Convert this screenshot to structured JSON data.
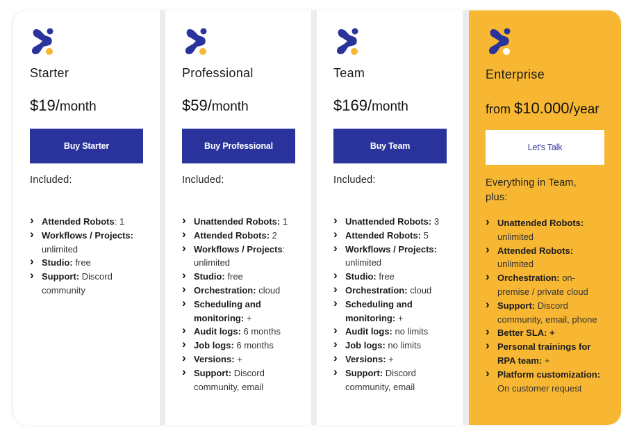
{
  "colors": {
    "brand_blue": "#29339b",
    "accent_yellow": "#f7b733",
    "card_bg": "#ffffff"
  },
  "plans": [
    {
      "logo_icon": "robot-dots-logo-icon",
      "name": "Starter",
      "price_amount": "$19/",
      "price_unit": "month",
      "button_label": "Buy Starter",
      "included_label": "Included:",
      "features": [
        {
          "label": "Attended Robots",
          "sep": ": ",
          "value": "1"
        },
        {
          "label": "Workflows / Projects:",
          "sep": " ",
          "value": "unlimited"
        },
        {
          "label": "Studio:",
          "sep": " ",
          "value": "free"
        },
        {
          "label": "Support:",
          "sep": " ",
          "value": "Discord community"
        }
      ]
    },
    {
      "logo_icon": "robot-dots-logo-icon",
      "name": "Professional",
      "price_amount": "$59/",
      "price_unit": "month",
      "button_label": "Buy Professional",
      "included_label": "Included:",
      "features": [
        {
          "label": "Unattended Robots:",
          "sep": " ",
          "value": "1"
        },
        {
          "label": "Attended Robots:",
          "sep": " ",
          "value": "2"
        },
        {
          "label": "Workflows / Projects",
          "sep": ": ",
          "value": "unlimited"
        },
        {
          "label": "Studio:",
          "sep": " ",
          "value": "free"
        },
        {
          "label": "Orchestration:",
          "sep": " ",
          "value": "cloud"
        },
        {
          "label": "Scheduling and monitoring:",
          "sep": " ",
          "value": "+"
        },
        {
          "label": "Audit logs:",
          "sep": " ",
          "value": "6 months"
        },
        {
          "label": "Job logs:",
          "sep": " ",
          "value": "6 months"
        },
        {
          "label": "Versions:",
          "sep": " ",
          "value": "+"
        },
        {
          "label": "Support:",
          "sep": " ",
          "value": "Discord community, email"
        }
      ]
    },
    {
      "logo_icon": "robot-dots-logo-icon",
      "name": "Team",
      "price_amount": "$169/",
      "price_unit": "month",
      "button_label": "Buy Team",
      "included_label": "Included:",
      "features": [
        {
          "label": "Unattended Robots:",
          "sep": " ",
          "value": "3"
        },
        {
          "label": "Attended Robots:",
          "sep": " ",
          "value": "5"
        },
        {
          "label": "Workflows / Projects:",
          "sep": " ",
          "value": "unlimited"
        },
        {
          "label": "Studio:",
          "sep": " ",
          "value": "free"
        },
        {
          "label": "Orchestration:",
          "sep": " ",
          "value": "cloud"
        },
        {
          "label": "Scheduling and monitoring:",
          "sep": " ",
          "value": "+"
        },
        {
          "label": "Audit logs:",
          "sep": " ",
          "value": "no limits"
        },
        {
          "label": "Job logs:",
          "sep": " ",
          "value": "no limits"
        },
        {
          "label": "Versions:",
          "sep": " ",
          "value": "+"
        },
        {
          "label": "Support:",
          "sep": " ",
          "value": "Discord community, email"
        }
      ]
    },
    {
      "logo_icon": "robot-dots-logo-icon",
      "name": "Enterprise",
      "price_prefix": "from ",
      "price_amount": "$10.000/",
      "price_unit": "year",
      "button_label": "Let's Talk",
      "included_label": "Everything in Team, plus:",
      "features": [
        {
          "label": "Unattended Robots:",
          "sep": " ",
          "value": "unlimited"
        },
        {
          "label": "Attended Robots:",
          "sep": " ",
          "value": "unlimited"
        },
        {
          "label": "Orchestration:",
          "sep": " ",
          "value": "on-premise / private cloud"
        },
        {
          "label": "Support:",
          "sep": " ",
          "value": "Discord community, email, phone"
        },
        {
          "label": "Better SLA: +",
          "sep": "",
          "value": ""
        },
        {
          "label": "Personal trainings for RPA team:",
          "sep": " ",
          "value": "+"
        },
        {
          "label": "Platform customization:",
          "sep": " ",
          "value": "On customer request"
        }
      ]
    }
  ]
}
